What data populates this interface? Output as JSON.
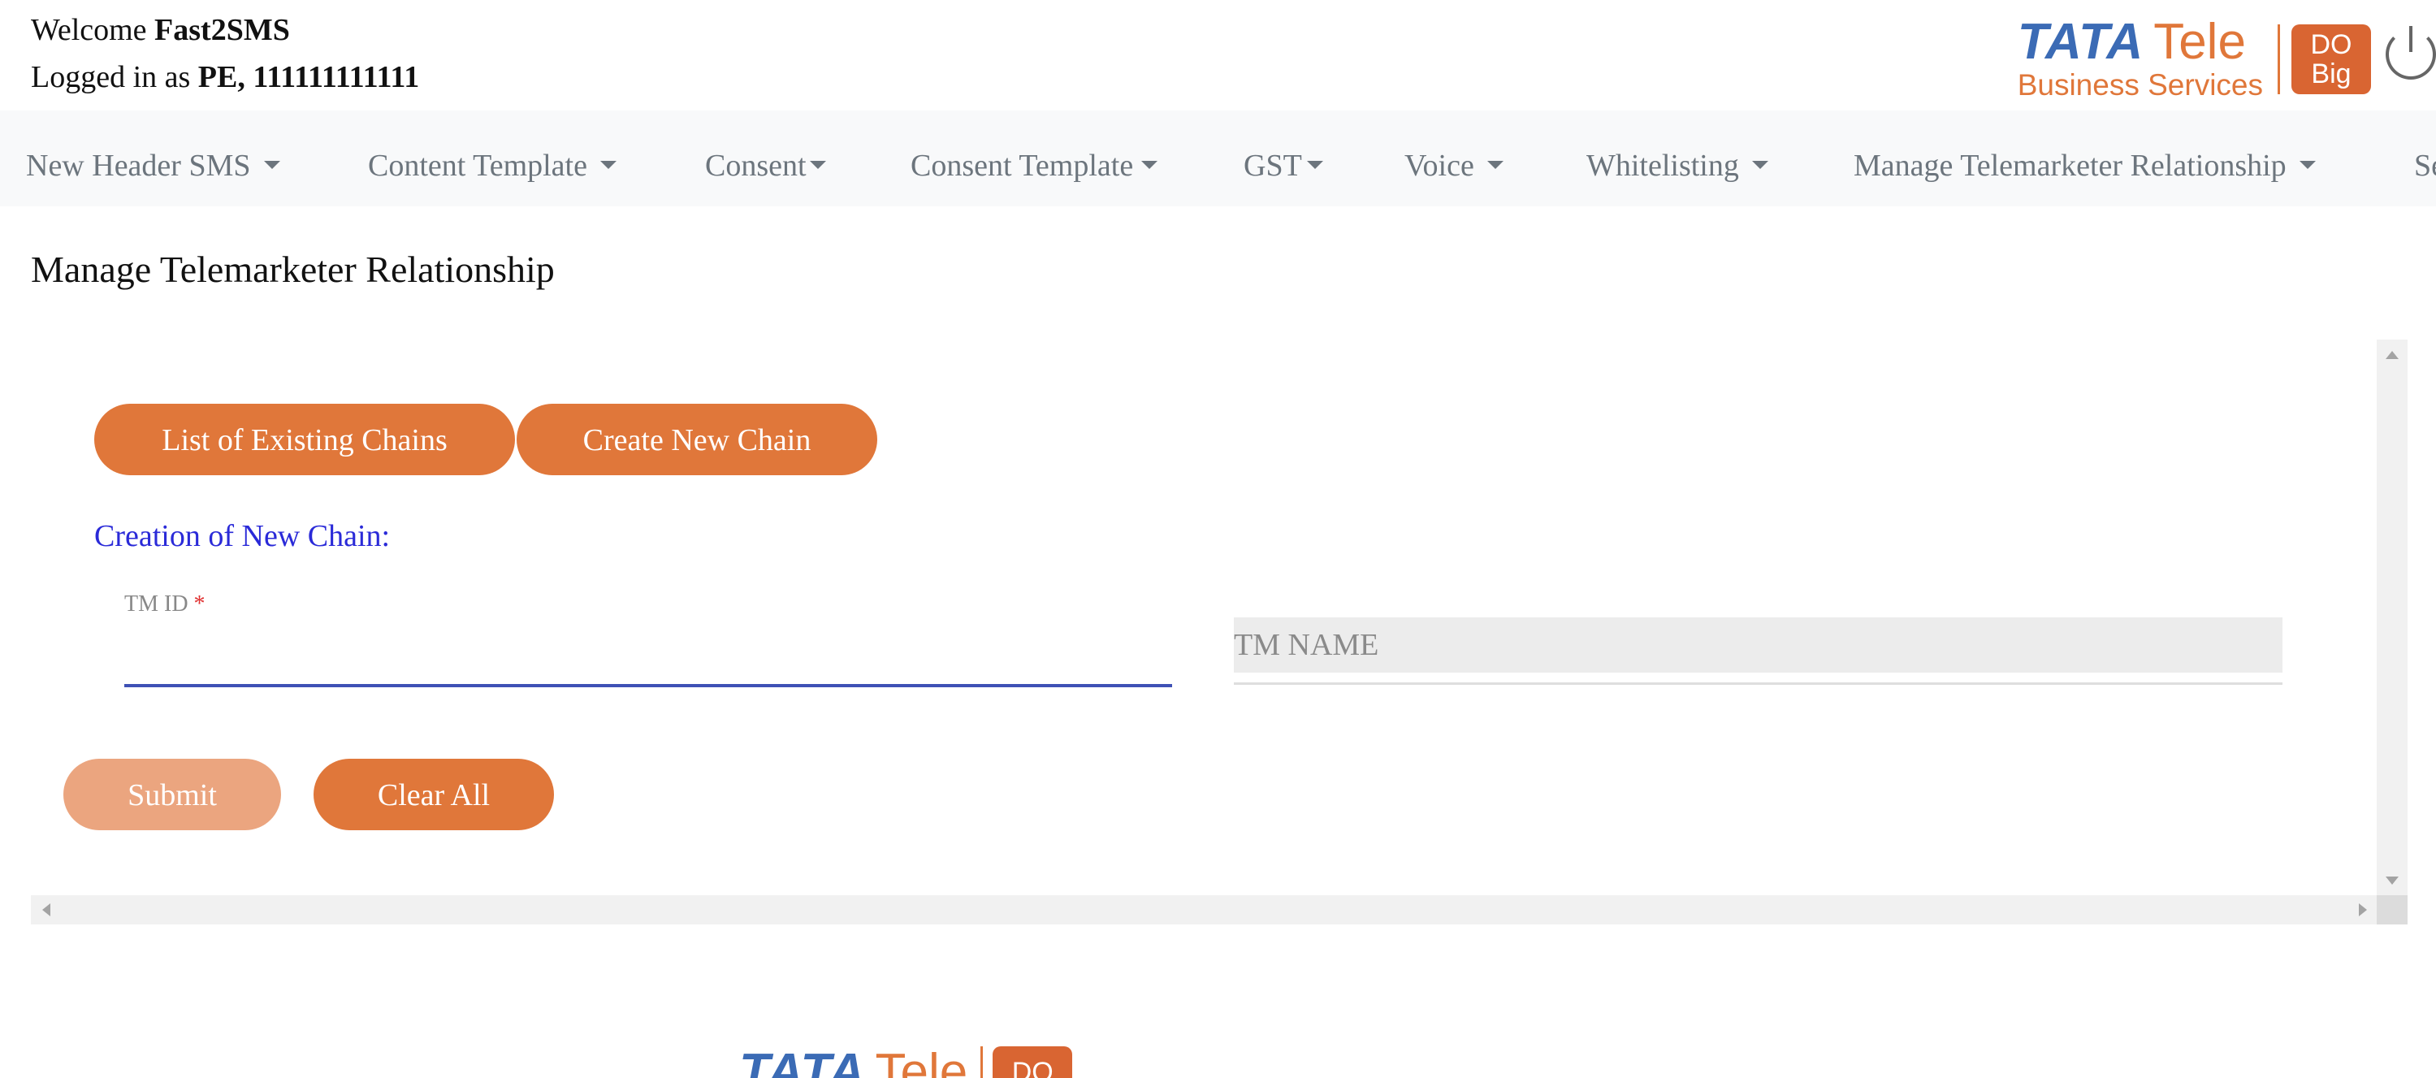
{
  "header": {
    "welcome_prefix": "Welcome",
    "company": "Fast2SMS",
    "logged_prefix": "Logged in as",
    "user_id": "PE, 111111111111",
    "logo": {
      "word1": "TATA",
      "word2": "Tele",
      "tagline": "Business Services",
      "badge_line1": "DO",
      "badge_line2": "Big"
    }
  },
  "nav": {
    "items": [
      {
        "label": "New Header SMS"
      },
      {
        "label": "Content Template"
      },
      {
        "label": "Consent"
      },
      {
        "label": "Consent Template"
      },
      {
        "label": "GST"
      },
      {
        "label": "Voice"
      },
      {
        "label": "Whitelisting"
      },
      {
        "label": "Manage Telemarketer Relationship"
      },
      {
        "label": "Se"
      }
    ]
  },
  "main": {
    "page_title": "Manage Telemarketer Relationship",
    "buttons": {
      "list_chains": "List of Existing Chains",
      "create_chain": "Create New Chain",
      "submit": "Submit",
      "clear_all": "Clear All"
    },
    "section_label": "Creation of New Chain:",
    "tm_id": {
      "label": "TM ID",
      "required": "*",
      "value": ""
    },
    "tm_name": {
      "placeholder": "TM NAME"
    }
  },
  "footer": {
    "logo": {
      "word1": "TATA",
      "word2": "Tele",
      "badge_line1": "DO"
    }
  },
  "colors": {
    "accent": "#e0773a",
    "accent_disabled": "#eba57f",
    "section_label": "#2a2ad8",
    "logo_blue": "#3b6bb5",
    "input_focus": "#3f51b5"
  }
}
